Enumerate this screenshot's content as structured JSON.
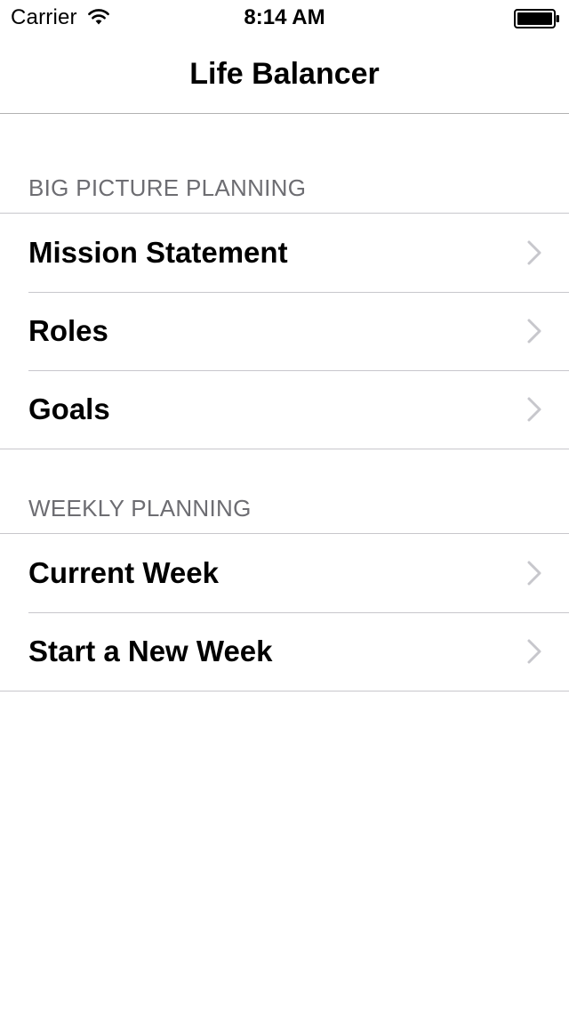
{
  "status_bar": {
    "carrier": "Carrier",
    "time": "8:14 AM",
    "icons": [
      "wifi-icon",
      "battery-icon"
    ]
  },
  "nav": {
    "title": "Life Balancer"
  },
  "sections": [
    {
      "header": "BIG PICTURE PLANNING",
      "items": [
        {
          "label": "Mission Statement",
          "icon": "chevron-right-icon"
        },
        {
          "label": "Roles",
          "icon": "chevron-right-icon"
        },
        {
          "label": "Goals",
          "icon": "chevron-right-icon"
        }
      ]
    },
    {
      "header": "WEEKLY PLANNING",
      "items": [
        {
          "label": "Current Week",
          "icon": "chevron-right-icon"
        },
        {
          "label": "Start a New Week",
          "icon": "chevron-right-icon"
        }
      ]
    }
  ],
  "colors": {
    "background": "#ffffff",
    "separator": "#c8c7cc",
    "section_header": "#6d6d72",
    "chevron": "#c7c7cc",
    "text": "#000000"
  }
}
